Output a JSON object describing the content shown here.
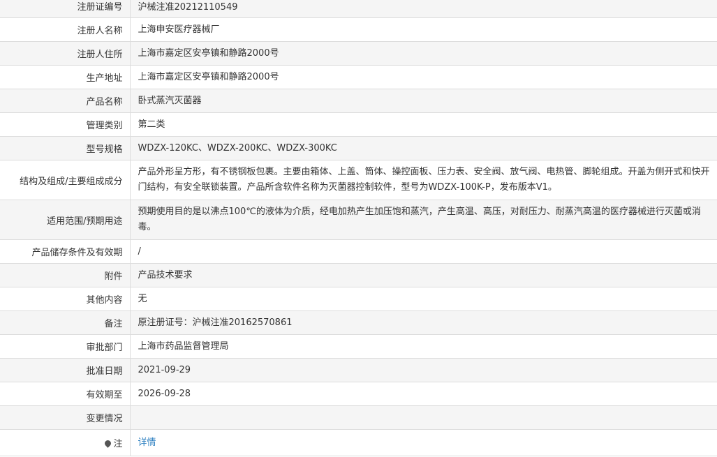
{
  "rows": [
    {
      "label": "注册证编号",
      "value": "沪械注准20212110549"
    },
    {
      "label": "注册人名称",
      "value": "上海申安医疗器械厂"
    },
    {
      "label": "注册人住所",
      "value": "上海市嘉定区安亭镇和静路2000号"
    },
    {
      "label": "生产地址",
      "value": "上海市嘉定区安亭镇和静路2000号"
    },
    {
      "label": "产品名称",
      "value": "卧式蒸汽灭菌器"
    },
    {
      "label": "管理类别",
      "value": "第二类"
    },
    {
      "label": "型号规格",
      "value": "WDZX-120KC、WDZX-200KC、WDZX-300KC"
    },
    {
      "label": "结构及组成/主要组成成分",
      "value": "产品外形呈方形，有不锈钢板包裹。主要由箱体、上盖、筒体、操控面板、压力表、安全阀、放气阀、电热管、脚轮组成。开盖为侧开式和快开门结构，有安全联锁装置。产品所含软件名称为灭菌器控制软件，型号为WDZX-100K-P，发布版本V1。"
    },
    {
      "label": "适用范围/预期用途",
      "value": "预期使用目的是以沸点100℃的液体为介质，经电加热产生加压饱和蒸汽，产生高温、高压，对耐压力、耐蒸汽高温的医疗器械进行灭菌或消毒。"
    },
    {
      "label": "产品储存条件及有效期",
      "value": "/"
    },
    {
      "label": "附件",
      "value": "产品技术要求"
    },
    {
      "label": "其他内容",
      "value": "无"
    },
    {
      "label": "备注",
      "value": "原注册证号：沪械注准20162570861"
    },
    {
      "label": "审批部门",
      "value": "上海市药品监督管理局"
    },
    {
      "label": "批准日期",
      "value": "2021-09-29"
    },
    {
      "label": "有效期至",
      "value": "2026-09-28"
    },
    {
      "label": "变更情况",
      "value": ""
    }
  ],
  "note": {
    "label": "注",
    "icon": "pin-icon",
    "link_text": "详情"
  },
  "colors": {
    "row_alt_bg": "#f5f5f5",
    "border": "#dcdcdc",
    "link": "#2a7ec0",
    "text": "#333333"
  }
}
